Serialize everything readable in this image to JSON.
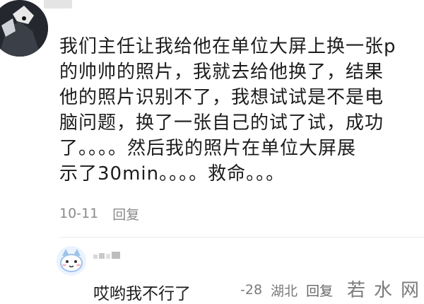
{
  "comment": {
    "lines": [
      "我们主任让我给他在单位大屏上换一张p",
      "的帅帅的照片，我就去给他换了，结果",
      "他的照片识别不了，我想试试是不是电",
      "脑问题，换了一张自己的试了试，成功",
      "了。。。。然后我的照片在单位大屏展",
      "示了30min。。。。救命。。。"
    ],
    "date": "10-11",
    "reply_label": "回复"
  },
  "sub_reply": {
    "text": "哎哟我不行了",
    "date_fragment": "-28",
    "location": "湖北",
    "reply_label": "回复"
  },
  "watermark": "若水网",
  "icons": {
    "main_avatar": "dark-anime-avatar-icon",
    "reply_avatar": "cartoon-cat-avatar-icon"
  },
  "colors": {
    "text": "#1c1c1c",
    "meta": "#8a8a8a",
    "background": "#ffffff"
  }
}
